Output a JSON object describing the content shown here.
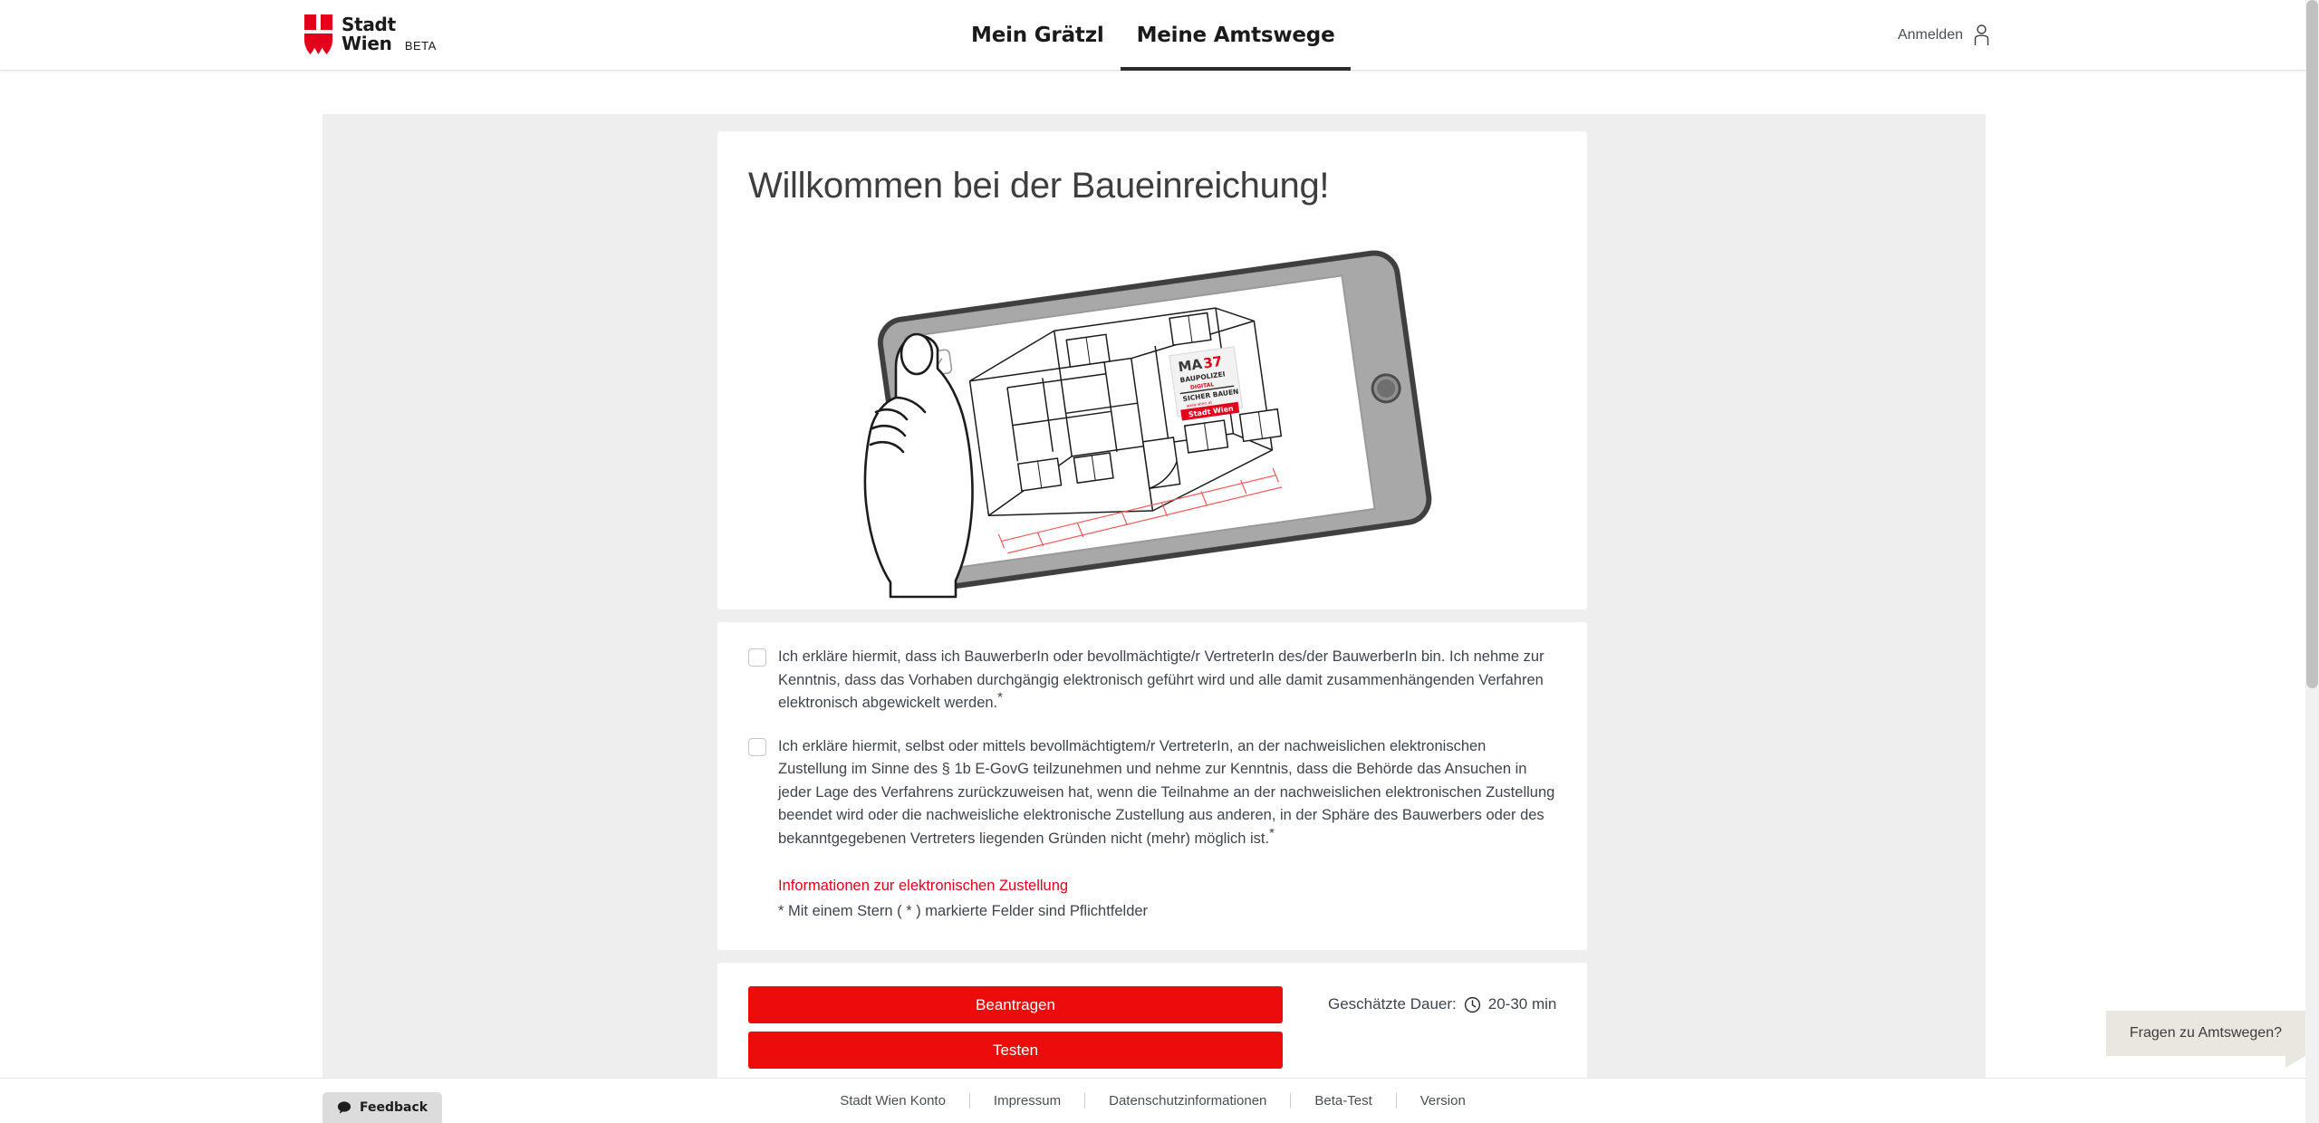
{
  "header": {
    "logo": {
      "line1": "Stadt",
      "line2": "Wien",
      "beta": "BETA",
      "shield_color": "#e3001b",
      "icon": "stadt-wien-shield-icon"
    },
    "nav": [
      {
        "label": "Mein Grätzl",
        "active": false
      },
      {
        "label": "Meine Amtswege",
        "active": true
      }
    ],
    "login": {
      "label": "Anmelden",
      "icon": "person-icon"
    }
  },
  "hero": {
    "title": "Willkommen bei der Baueinreichung!",
    "illustration": {
      "name": "hand-holding-tablet-with-building-plan-illustration",
      "poster_line1": "MA37",
      "poster_line2": "BAUPOLIZEI",
      "poster_line3": "DIGITAL",
      "poster_line4": "SICHER BAUEN",
      "poster_line5": "www.wien.at",
      "poster_badge": "Stadt Wien",
      "accent_color": "#e3001b"
    }
  },
  "declarations": {
    "items": [
      {
        "checked": false,
        "text": "Ich erkläre hiermit, dass ich BauwerberIn oder bevollmächtigte/r VertreterIn des/der BauwerberIn bin. Ich nehme zur Kenntnis, dass das Vorhaben durchgängig elektronisch geführt wird und alle damit zusammenhängenden Verfahren elektronisch abgewickelt werden.",
        "required_marker": "*"
      },
      {
        "checked": false,
        "text": "Ich erkläre hiermit, selbst oder mittels bevollmächtigtem/r VertreterIn, an der nachweislichen elektronischen Zustellung im Sinne des § 1b E-GovG teilzunehmen und nehme zur Kenntnis, dass die Behörde das Ansuchen in jeder Lage des Verfahrens zurückzuweisen hat, wenn die Teilnahme an der nachweislichen elektronischen Zustellung beendet wird oder die nachweisliche elektronische Zustellung aus anderen, in der Sphäre des Bauwerbers oder des bekanntgegebenen Vertreters liegenden Gründen nicht (mehr) möglich ist.",
        "required_marker": "*"
      }
    ],
    "info_link": "Informationen zur elektronischen Zustellung",
    "required_note": "* Mit einem Stern ( * ) markierte Felder sind Pflichtfelder",
    "link_color": "#e3001b"
  },
  "actions": {
    "primary_label": "Beantragen",
    "secondary_label": "Testen",
    "button_color": "#ed0c0c",
    "duration_label": "Geschätzte Dauer:",
    "duration_value": "20-30 min",
    "duration_icon": "clock-icon"
  },
  "footer": {
    "links": [
      "Stadt Wien Konto",
      "Impressum",
      "Datenschutzinformationen",
      "Beta-Test",
      "Version"
    ]
  },
  "feedback": {
    "label": "Feedback",
    "icon": "chat-bubble-icon"
  },
  "chat_widget": {
    "label": "Fragen zu Amtswegen?"
  }
}
